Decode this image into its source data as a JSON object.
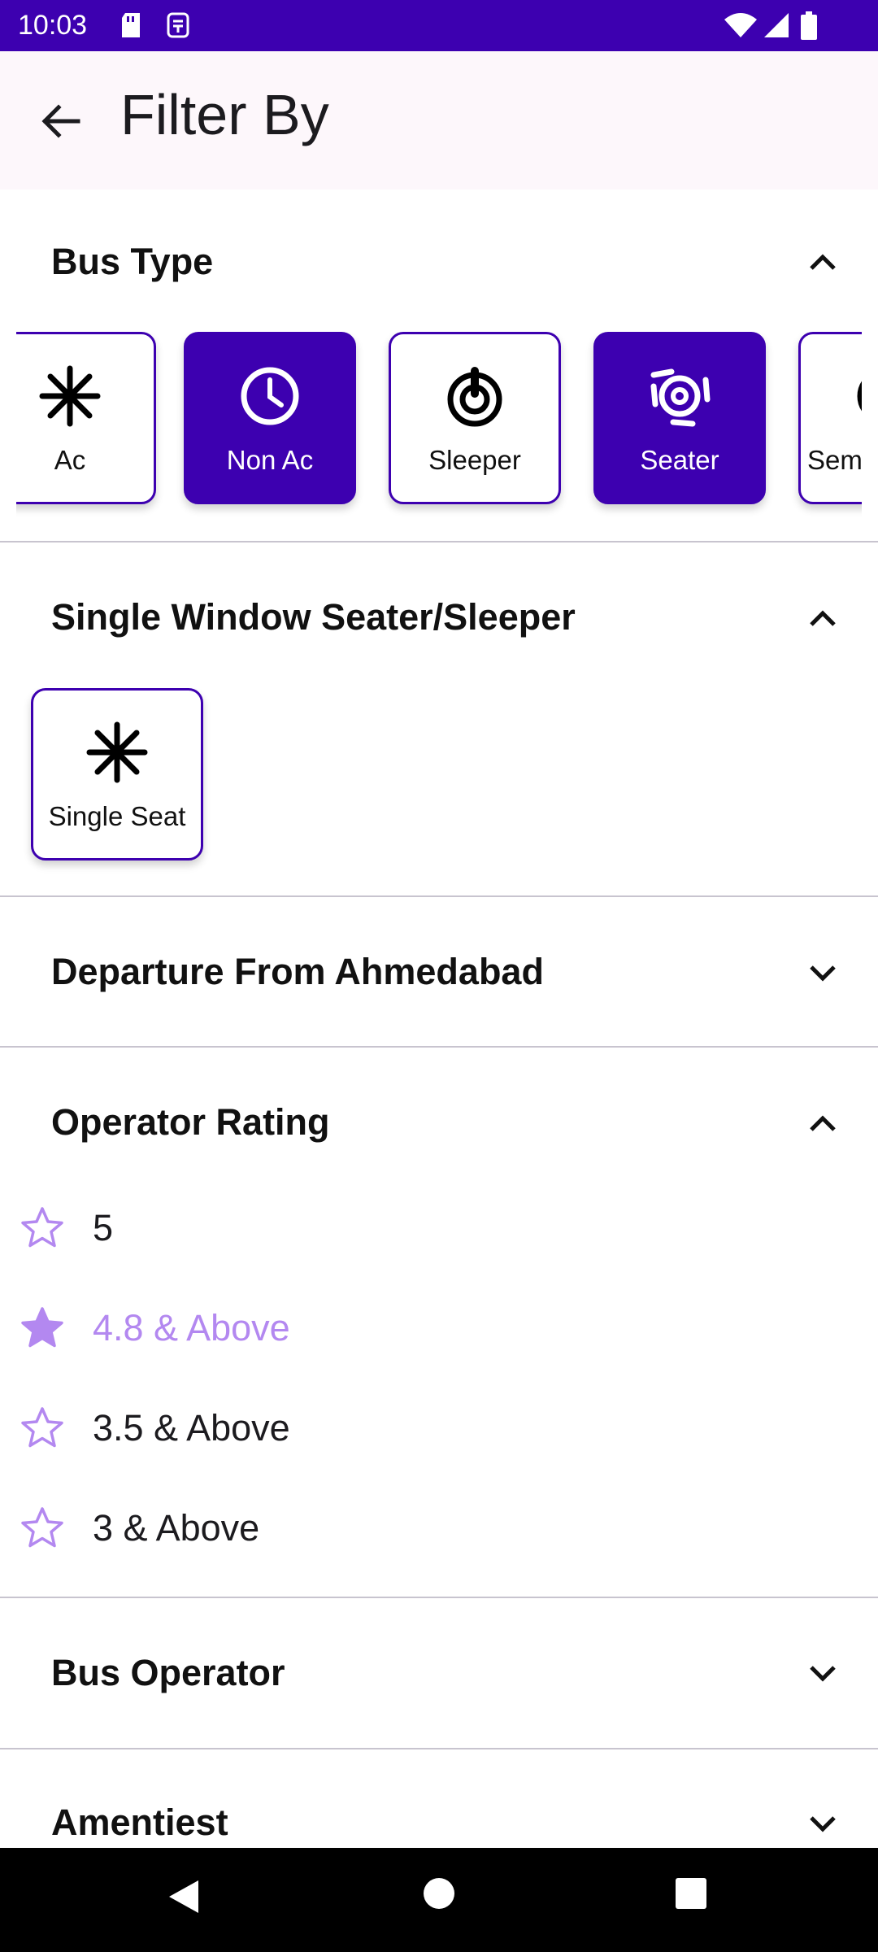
{
  "status_bar": {
    "time": "10:03"
  },
  "app_bar": {
    "title": "Filter By"
  },
  "sections": {
    "bus_type": {
      "title": "Bus Type",
      "chips": [
        {
          "label": "Ac",
          "icon": "snowflake-icon",
          "selected": false
        },
        {
          "label": "Non Ac",
          "icon": "clock-icon",
          "selected": true
        },
        {
          "label": "Sleeper",
          "icon": "sleeper-icon",
          "selected": false
        },
        {
          "label": "Seater",
          "icon": "seater-icon",
          "selected": true
        },
        {
          "label": "Sem",
          "icon": "semi-sleeper-icon",
          "selected": false
        }
      ]
    },
    "single_window": {
      "title": "Single Window Seater/Sleeper",
      "chips": [
        {
          "label": "Single Seat",
          "icon": "snowflake-icon",
          "selected": false
        }
      ]
    },
    "departure": {
      "title": "Departure From Ahmedabad"
    },
    "operator_rating": {
      "title": "Operator Rating",
      "options": [
        {
          "label": "5",
          "selected": false
        },
        {
          "label": "4.8 & Above",
          "selected": true
        },
        {
          "label": "3.5 & Above",
          "selected": false
        },
        {
          "label": "3 & Above",
          "selected": false
        }
      ]
    },
    "bus_operator": {
      "title": "Bus Operator"
    },
    "amenities": {
      "title": "Amentiest"
    }
  },
  "colors": {
    "primary": "#3d00b0",
    "accent_star": "#b388f0",
    "appbar_bg": "#fdf7fb"
  }
}
